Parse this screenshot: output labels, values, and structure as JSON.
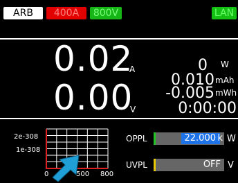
{
  "status_bar": {
    "mode": "ARB",
    "current_range": "400A",
    "voltage_range": "800V",
    "network": "LAN"
  },
  "readings": {
    "current_value": "0.02",
    "current_unit": "A",
    "voltage_value": "0.00",
    "voltage_unit": "V",
    "power_value": "0",
    "power_unit": "W",
    "capacity_value": "0.010",
    "capacity_unit": "mAh",
    "energy_value": "-0.005",
    "energy_unit": "mWh",
    "elapsed_time": "0:00:00"
  },
  "graph": {
    "y_ticks": [
      "2e-308",
      "1e-308"
    ],
    "x_ticks": [
      "0",
      "500",
      "800"
    ],
    "colors": {
      "grid": "#ffffff",
      "axis": "#e02020",
      "pointer": "#1f9fd6"
    },
    "pointer_icon": "arrow-pointer-icon"
  },
  "settings": {
    "oppl_label": "OPPL",
    "oppl_value": "22.000",
    "oppl_unit_prefix": "k",
    "oppl_unit": "W",
    "uvpl_label": "UVPL",
    "uvpl_value": "OFF",
    "uvpl_unit": "V",
    "colors": {
      "oppl_marker": "#22c422",
      "uvpl_marker": "#e8c800",
      "edit_highlight": "#1e73e8"
    }
  }
}
